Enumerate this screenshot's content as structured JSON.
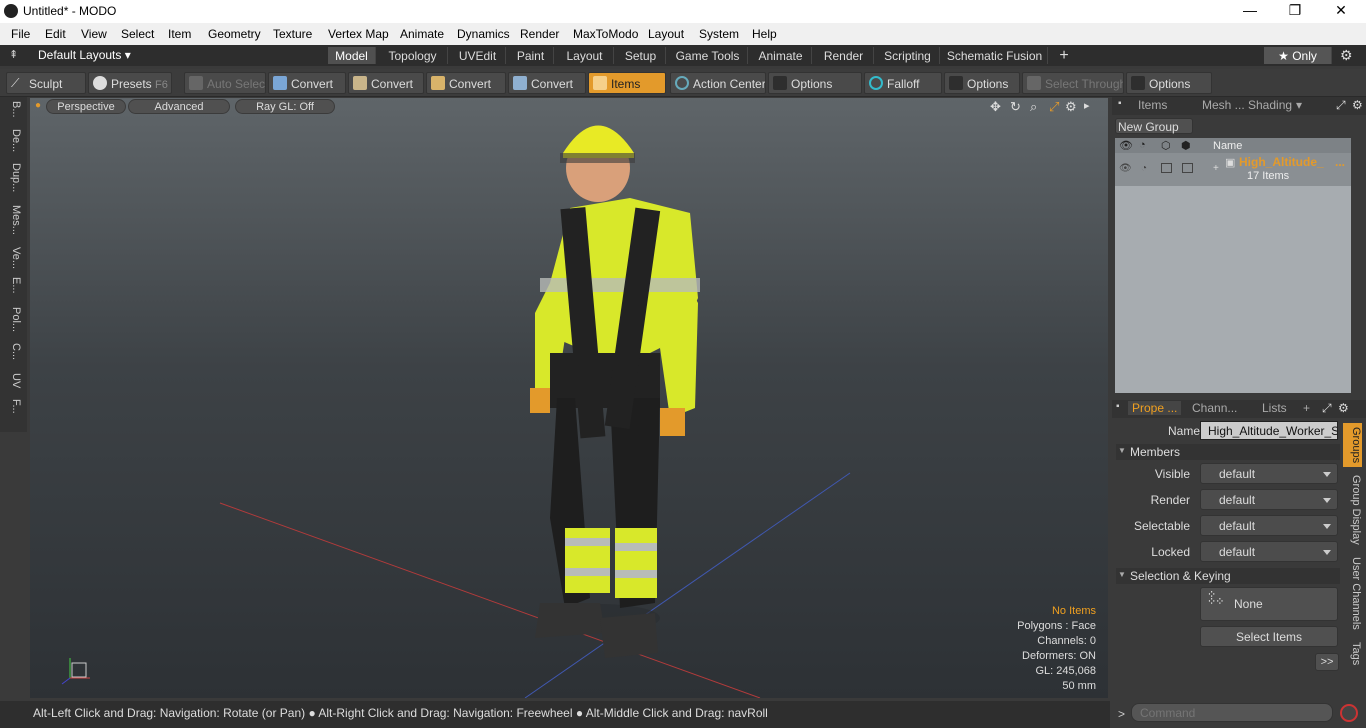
{
  "window": {
    "title": "Untitled* - MODO",
    "minimize": "—",
    "maximize": "❐",
    "close": "✕"
  },
  "menu": [
    "File",
    "Edit",
    "View",
    "Select",
    "Item",
    "Geometry",
    "Texture",
    "Vertex Map",
    "Animate",
    "Dynamics",
    "Render",
    "MaxToModo",
    "Layout",
    "System",
    "Help"
  ],
  "layouts": {
    "label": "Default Layouts ▾",
    "only_label": "★ Only"
  },
  "tabs": [
    "Model",
    "Topology",
    "UVEdit",
    "Paint",
    "Layout",
    "Setup",
    "Game Tools",
    "Animate",
    "Render",
    "Scripting",
    "Schematic Fusion",
    "+"
  ],
  "toolbar": {
    "sculpt": "Sculpt",
    "presets": "Presets",
    "presets_key": "F6",
    "auto_select": "Auto Select",
    "convert1": "Convert",
    "convert2": "Convert",
    "convert3": "Convert",
    "convert4": "Convert",
    "items": "Items",
    "action_center": "Action Center",
    "options1": "Options",
    "falloff": "Falloff",
    "options2": "Options",
    "select_through": "Select Through",
    "options3": "Options"
  },
  "left_tabs": [
    "B...",
    "De...",
    "Dup...",
    "Mes...",
    "Ve...",
    "E...",
    "Pol...",
    "C...",
    "UV",
    "F..."
  ],
  "viewport": {
    "view": "Perspective",
    "advanced": "Advanced",
    "raygl": "Ray GL: Off",
    "info": {
      "no_items": "No Items",
      "polygons": "Polygons : Face",
      "channels": "Channels: 0",
      "deformers": "Deformers: ON",
      "gl": "GL: 245,068",
      "scale": "50 mm"
    }
  },
  "status": {
    "text1": "Alt-Left Click and Drag: Navigation: Rotate (or Pan)",
    "text2": "Alt-Right Click and Drag: Navigation: Freewheel",
    "text3": "Alt-Middle Click and Drag: navRoll"
  },
  "items_panel": {
    "tabs": [
      "Items",
      "Mesh ...",
      "Shading"
    ],
    "new_group": "New Group",
    "col_name": "Name",
    "group_name": "High_Altitude_",
    "group_ellipsis": "...",
    "group_count": "17 Items"
  },
  "properties": {
    "tabs": [
      "Prope ...",
      "Chann...",
      "Lists",
      "+"
    ],
    "name_label": "Name",
    "name_value": "High_Altitude_Worker_Sta",
    "members": "Members",
    "rows": [
      {
        "label": "Visible",
        "value": "default"
      },
      {
        "label": "Render",
        "value": "default"
      },
      {
        "label": "Selectable",
        "value": "default"
      },
      {
        "label": "Locked",
        "value": "default"
      }
    ],
    "sel_keying": "Selection & Keying",
    "none": "None",
    "select_items": "Select Items",
    "more": ">>",
    "side_tabs": [
      "Groups",
      "Group Display",
      "User Channels",
      "Tags"
    ]
  },
  "command": {
    "prompt": ">",
    "placeholder": "Command"
  },
  "colors": {
    "accent": "#e39a2b",
    "active_text": "#f0a020"
  }
}
